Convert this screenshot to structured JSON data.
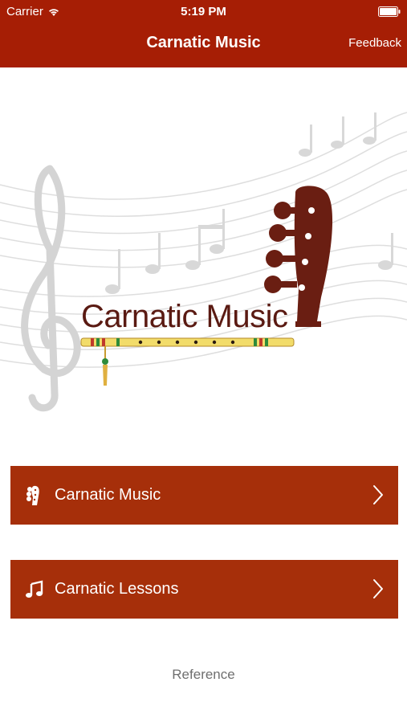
{
  "status_bar": {
    "carrier": "Carrier",
    "time": "5:19 PM"
  },
  "nav": {
    "title": "Carnatic Music",
    "feedback_label": "Feedback"
  },
  "logo": {
    "text": "Carnatic Music"
  },
  "menu": [
    {
      "label": "Carnatic Music",
      "icon": "guitar-headstock-icon"
    },
    {
      "label": "Carnatic Lessons",
      "icon": "music-note-icon"
    }
  ],
  "footer": {
    "reference_label": "Reference"
  },
  "colors": {
    "nav_bar": "#a61e05",
    "menu_button": "#a62f0a",
    "logo_text": "#5a1a12",
    "flute_gold": "#f2dc6a"
  }
}
